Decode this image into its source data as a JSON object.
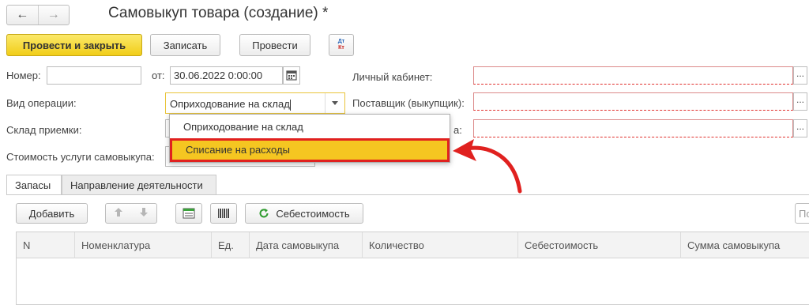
{
  "window": {
    "title": "Самовыкуп товара (создание) *"
  },
  "nav": {
    "back": "←",
    "forward": "→"
  },
  "toolbar": {
    "post_close": "Провести и закрыть",
    "save": "Записать",
    "post": "Провести",
    "dt": "Дт",
    "kt": "Кт"
  },
  "form": {
    "number_label": "Номер:",
    "number_value": "",
    "from_label": "от:",
    "date_value": "30.06.2022  0:00:00",
    "operation_label": "Вид операции:",
    "operation_value": "Оприходование на склад",
    "warehouse_label": "Склад приемки:",
    "cost_label": "Стоимость услуги самовыкупа:",
    "cabinet_label": "Личный кабинет:",
    "supplier_label": "Поставщик (выкупщик):",
    "third_label_tail": "а:",
    "dots": "..."
  },
  "dropdown": {
    "options": [
      "Оприходование на склад",
      "Списание на расходы"
    ],
    "selected_index": 1
  },
  "tabs": [
    "Запасы",
    "Направление деятельности"
  ],
  "table_toolbar": {
    "add": "Добавить",
    "cost": "Себестоимость",
    "search_placeholder": "По"
  },
  "table": {
    "columns": [
      "N",
      "Номенклатура",
      "Ед.",
      "Дата самовыкупа",
      "Количество",
      "Себестоимость",
      "Сумма самовыкупа"
    ]
  },
  "colors": {
    "accent_yellow": "#f5c621",
    "highlight_red": "#e0211f",
    "arrow_red": "#e0211f"
  }
}
